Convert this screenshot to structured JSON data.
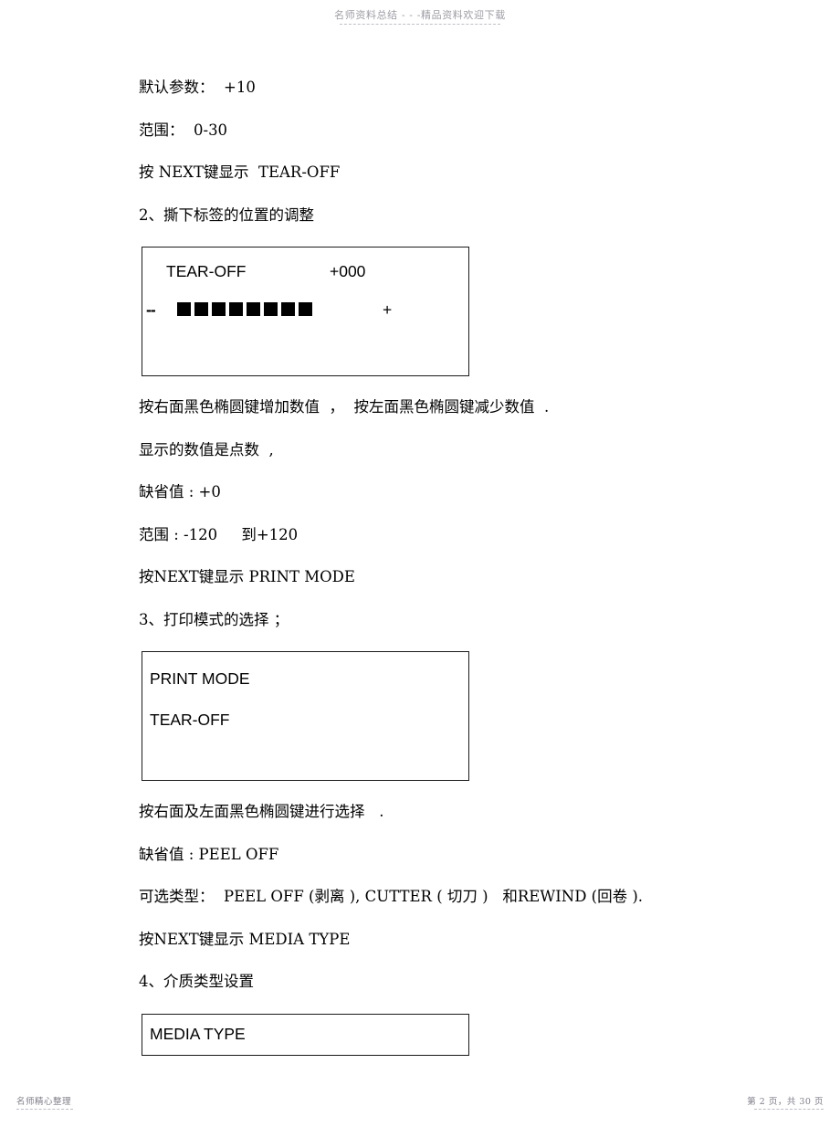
{
  "header": {
    "watermark": "名师资料总结 - - -精品资料欢迎下载"
  },
  "body": {
    "paragraphs_before_box1": [
      "默认参数：  +10",
      "范围：  0-30",
      "按 NEXT键显示  TEAR-OFF",
      "2、撕下标签的位置的调整"
    ],
    "paragraphs_after_box1": [
      "按右面黑色椭圆键增加数值  ，  按左面黑色椭圆键减少数值  .",
      "显示的数值是点数  ,",
      "缺省值 : +0",
      "范围 : -120     到+120",
      "按NEXT键显示 PRINT MODE",
      "3、打印模式的选择 ；"
    ],
    "paragraphs_after_box2": [
      "按右面及左面黑色椭圆键进行选择   .",
      "缺省值 : PEEL OFF",
      "可选类型：  PEEL OFF (剥离 ), CUTTER ( 切刀 )   和REWIND (回卷 ).",
      "按NEXT键显示 MEDIA TYPE",
      "4、介质类型设置"
    ]
  },
  "lcd_panels": [
    {
      "name": "tear-off-adjust",
      "title": "TEAR-OFF",
      "value": "+000",
      "minus_label": "--",
      "plus_label": "+",
      "bar_segments": 8
    },
    {
      "name": "print-mode",
      "line1": "PRINT MODE",
      "line2": "TEAR-OFF"
    },
    {
      "name": "media-type",
      "line1": "MEDIA TYPE"
    }
  ],
  "footer": {
    "left": "名师精心整理",
    "right": "第 2 页，共 30 页"
  }
}
